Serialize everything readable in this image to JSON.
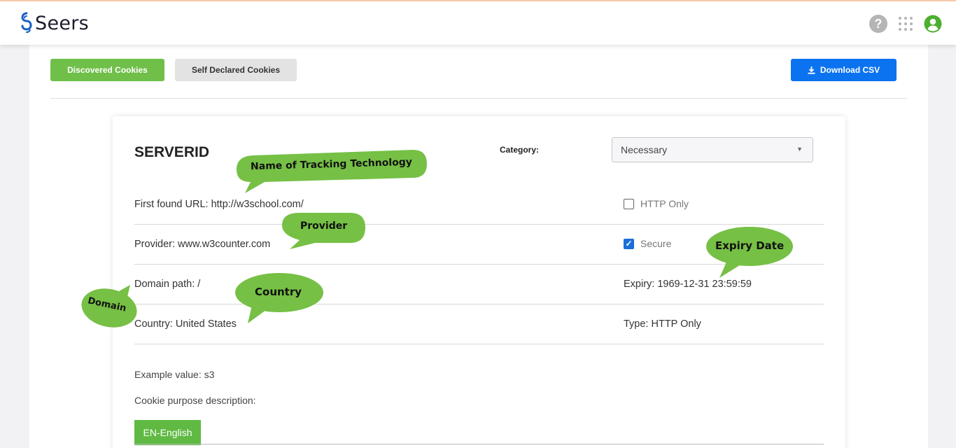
{
  "app": {
    "brand_name": "Seers"
  },
  "header_icons": [
    "help-icon",
    "apps-grid-icon",
    "user-account-icon"
  ],
  "toolbar": {
    "discovered_label": "Discovered Cookies",
    "declared_label": "Self Declared Cookies",
    "download_label": "Download CSV"
  },
  "cookie": {
    "name": "SERVERID",
    "category_label": "Category:",
    "category_value": "Necessary",
    "first_found_url": "First found URL: http://w3school.com/",
    "provider": "Provider: www.w3counter.com",
    "domain_path": "Domain path: /",
    "country": "Country: United States",
    "http_only_label": "HTTP Only",
    "http_only_checked": false,
    "secure_label": "Secure",
    "secure_checked": true,
    "expiry": "Expiry: 1969-12-31 23:59:59",
    "type": "Type: HTTP Only",
    "example_value": "Example value: s3",
    "purpose_label": "Cookie purpose description:",
    "language_button": "EN-English"
  },
  "callouts": {
    "name_tracking": "Name of Tracking Technology",
    "provider": "Provider",
    "expiry_date": "Expiry Date",
    "country": "Country",
    "domain": "Domain",
    "color": "#76c045"
  },
  "colors": {
    "accent_green": "#6fbf49",
    "download_blue": "#0b73f0",
    "checkbox_blue": "#1a6fd8"
  }
}
